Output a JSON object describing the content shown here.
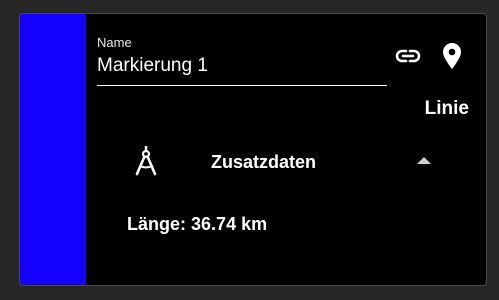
{
  "marker": {
    "color": "#1400ff",
    "name_label": "Name",
    "name_value": "Markierung 1",
    "type": "Linie"
  },
  "icons": {
    "link": "link-icon",
    "pin": "map-pin-icon",
    "compass": "drafting-compass-icon",
    "collapse": "chevron-up-icon"
  },
  "extra": {
    "title": "Zusatzdaten",
    "length_label": "Länge:",
    "length_value": "36.74 km"
  }
}
